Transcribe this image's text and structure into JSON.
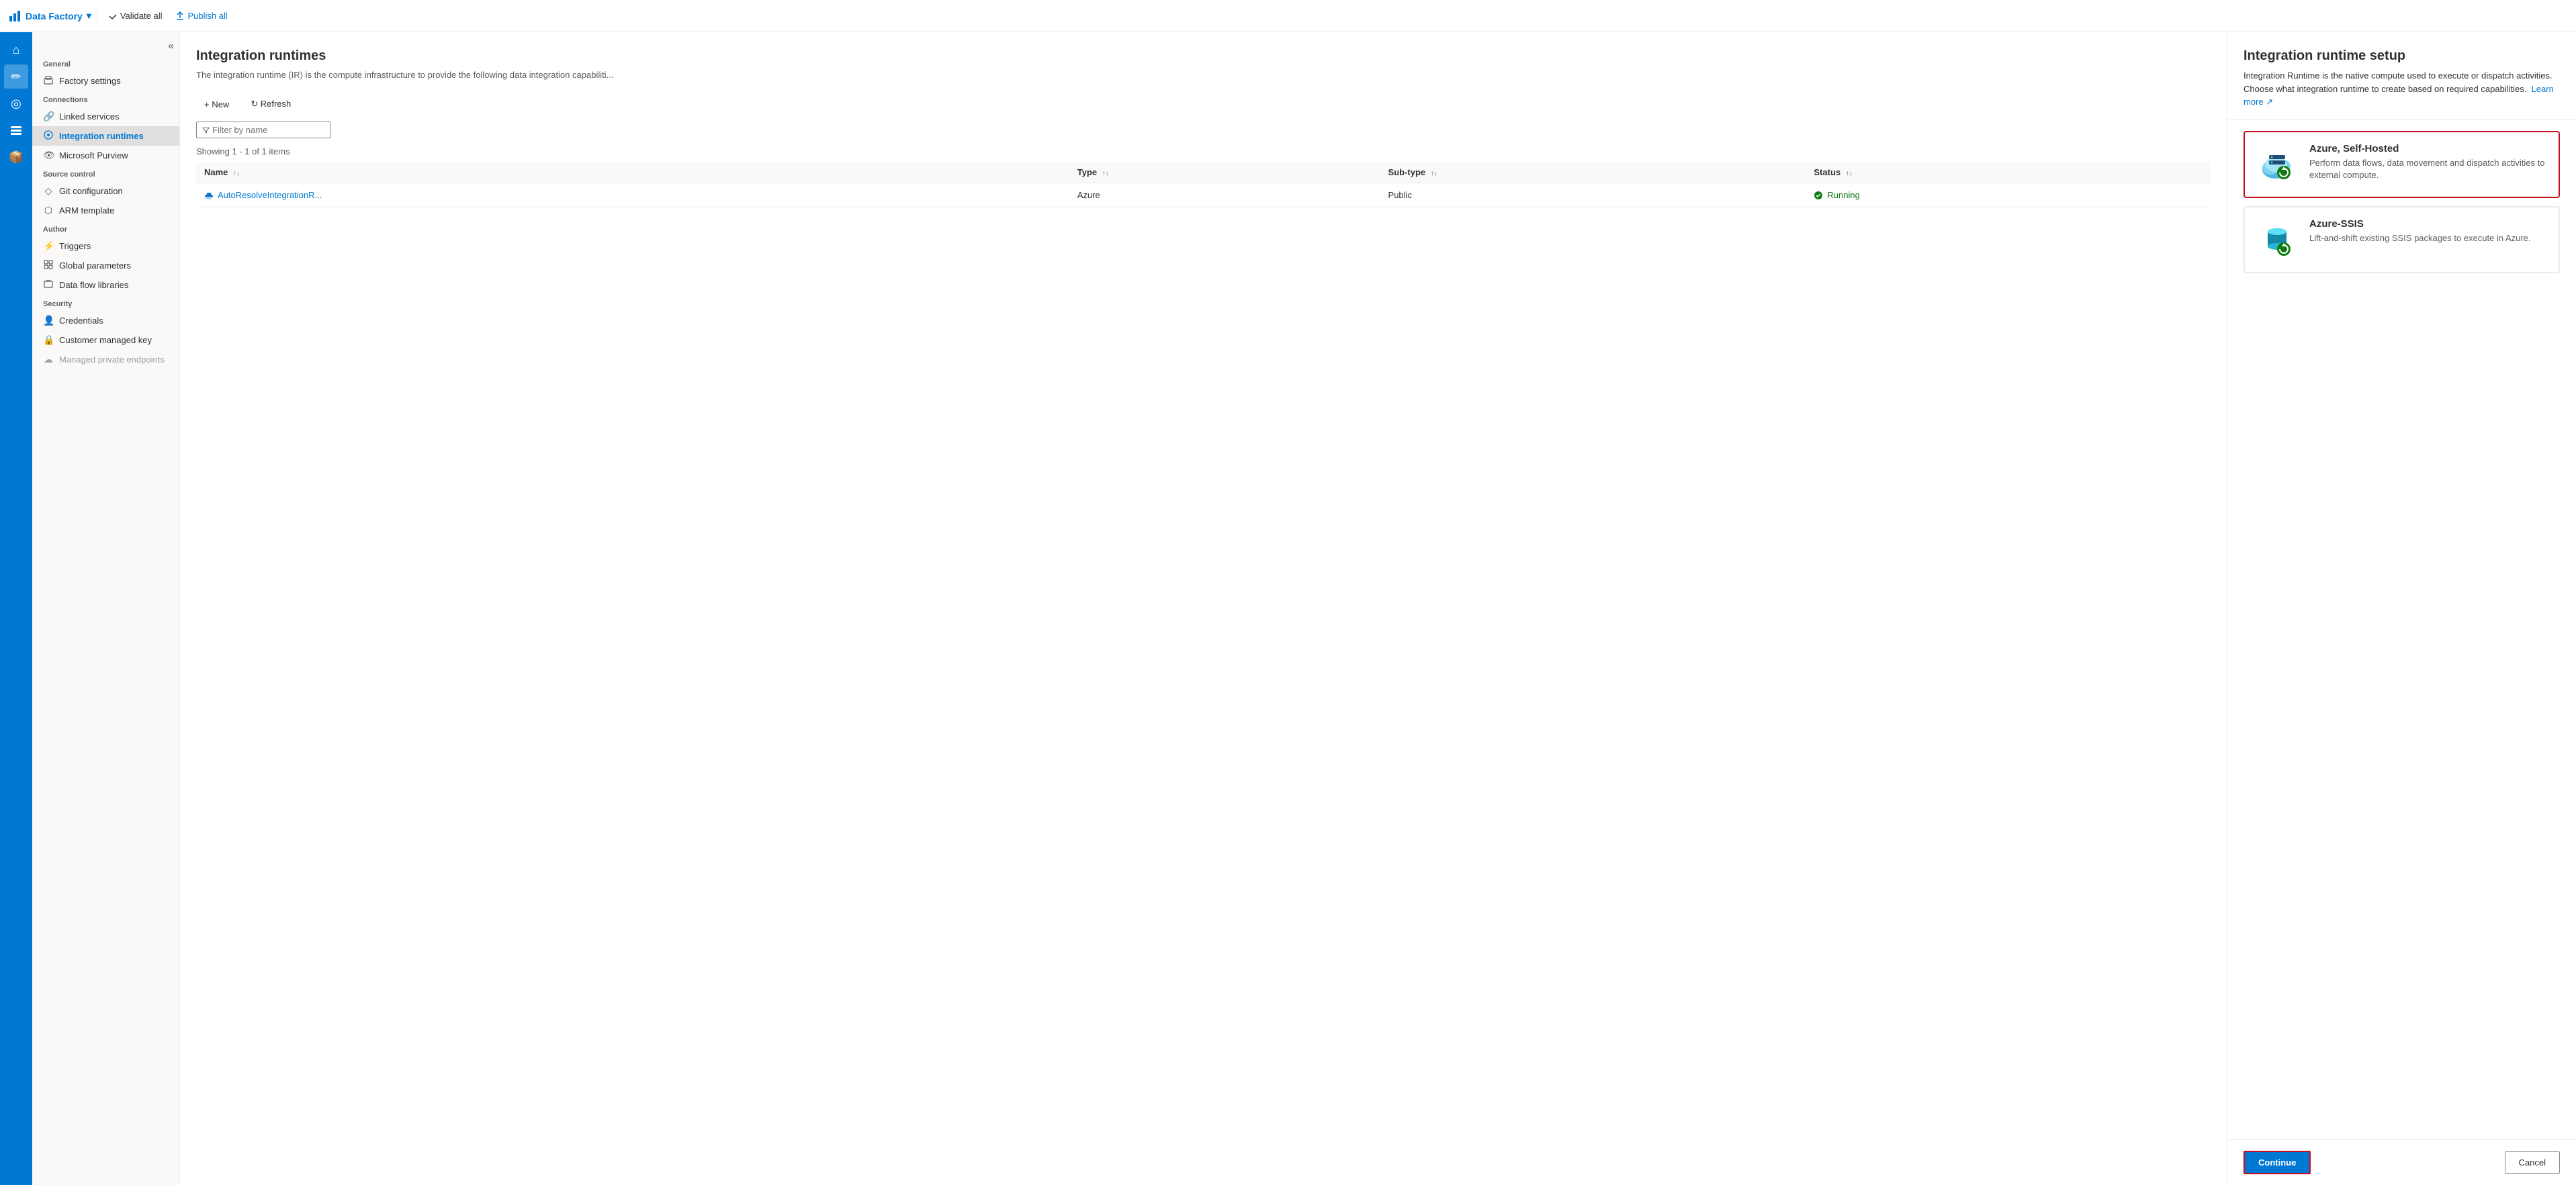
{
  "topbar": {
    "brand_label": "Data Factory",
    "chevron": "▾",
    "actions": [
      {
        "id": "validate",
        "label": "Validate all",
        "icon": "✔"
      },
      {
        "id": "publish",
        "label": "Publish all",
        "icon": "↑"
      }
    ]
  },
  "sidebar": {
    "collapse_icon": "«",
    "sections": [
      {
        "label": "General",
        "items": [
          {
            "id": "factory-settings",
            "label": "Factory settings",
            "icon": "📊"
          }
        ]
      },
      {
        "label": "Connections",
        "items": [
          {
            "id": "linked-services",
            "label": "Linked services",
            "icon": "🔗"
          },
          {
            "id": "integration-runtimes",
            "label": "Integration runtimes",
            "icon": "⚙",
            "active": true
          }
        ]
      },
      {
        "label": "",
        "items": [
          {
            "id": "microsoft-purview",
            "label": "Microsoft Purview",
            "icon": "👁"
          }
        ]
      },
      {
        "label": "Source control",
        "items": [
          {
            "id": "git-configuration",
            "label": "Git configuration",
            "icon": "◇"
          },
          {
            "id": "arm-template",
            "label": "ARM template",
            "icon": "⬡"
          }
        ]
      },
      {
        "label": "Author",
        "items": [
          {
            "id": "triggers",
            "label": "Triggers",
            "icon": "⚡"
          },
          {
            "id": "global-parameters",
            "label": "Global parameters",
            "icon": "⊞"
          },
          {
            "id": "data-flow-libraries",
            "label": "Data flow libraries",
            "icon": "📁"
          }
        ]
      },
      {
        "label": "Security",
        "items": [
          {
            "id": "credentials",
            "label": "Credentials",
            "icon": "👤"
          },
          {
            "id": "customer-managed-key",
            "label": "Customer managed key",
            "icon": "🔒"
          },
          {
            "id": "managed-private-endpoints",
            "label": "Managed private endpoints",
            "icon": "☁",
            "disabled": true
          }
        ]
      }
    ]
  },
  "main": {
    "title": "Integration runtimes",
    "subtitle": "The integration runtime (IR) is the compute infrastructure to provide the following data integration capabiliti...",
    "toolbar": {
      "new_label": "+ New",
      "refresh_label": "↻ Refresh"
    },
    "filter_placeholder": "Filter by name",
    "showing_text": "Showing 1 - 1 of 1 items",
    "table": {
      "columns": [
        "Name",
        "Type",
        "Sub-type",
        "Status"
      ],
      "rows": [
        {
          "name": "AutoResolveIntegrationR...",
          "type": "Azure",
          "subtype": "Public",
          "status": "Running"
        }
      ]
    }
  },
  "right_panel": {
    "title": "Integration runtime setup",
    "description": "Integration Runtime is the native compute used to execute or dispatch activities. Choose what integration runtime to create based on required capabilities.",
    "learn_more_label": "Learn more",
    "options": [
      {
        "id": "azure-self-hosted",
        "title": "Azure, Self-Hosted",
        "description": "Perform data flows, data movement and dispatch activities to external compute.",
        "selected": true
      },
      {
        "id": "azure-ssis",
        "title": "Azure-SSIS",
        "description": "Lift-and-shift existing SSIS packages to execute in Azure.",
        "selected": false
      }
    ],
    "footer": {
      "continue_label": "Continue",
      "cancel_label": "Cancel"
    }
  },
  "rail_icons": [
    {
      "id": "home",
      "symbol": "⌂"
    },
    {
      "id": "edit",
      "symbol": "✏"
    },
    {
      "id": "monitor",
      "symbol": "◎"
    },
    {
      "id": "manage",
      "symbol": "🗂"
    },
    {
      "id": "deploy",
      "symbol": "📦"
    }
  ]
}
